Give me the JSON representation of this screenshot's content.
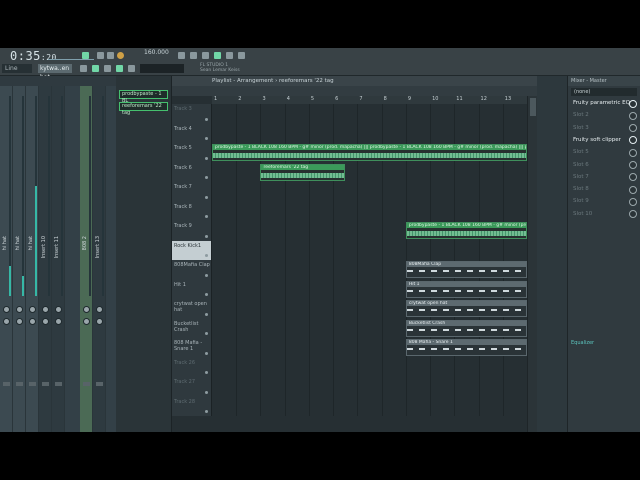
{
  "toolbar": {
    "time_main": "0:35",
    "time_sub": ":20",
    "tempo_value": "160.000",
    "line_label": "Line",
    "preset_label": "kytwa..en hat",
    "hint_lines": [
      "FL STUDIO 1",
      "Sean Lemar Keiss"
    ]
  },
  "mixer": {
    "strips": [
      {
        "name": "hi hat",
        "level": 0.15
      },
      {
        "name": "hi hat",
        "level": 0.1
      },
      {
        "name": "hi hat",
        "level": 0.55
      },
      {
        "name": "Insert 10",
        "level": 0.0
      },
      {
        "name": "Insert 11",
        "level": 0.0
      },
      {
        "name": "808 2",
        "level": 0.0
      },
      {
        "name": "Insert 13",
        "level": 0.0
      }
    ]
  },
  "rack": {
    "clips": [
      "prodbypaste - 1 BL",
      "reeforemars '22 tag"
    ]
  },
  "playlist": {
    "title": "Playlist - Arrangement",
    "pattern": "reeforemars '22 tag",
    "bars": [
      "1",
      "2",
      "3",
      "4",
      "5",
      "6",
      "7",
      "8",
      "9",
      "10",
      "11",
      "12",
      "13"
    ],
    "tracks": [
      {
        "name": "Track 3",
        "dim": true
      },
      {
        "name": "Track 4"
      },
      {
        "name": "Track 5"
      },
      {
        "name": "Track 6"
      },
      {
        "name": "Track 7"
      },
      {
        "name": "Track 8"
      },
      {
        "name": "Track 9"
      },
      {
        "name": "Rock Kick1",
        "highlight": true
      },
      {
        "name": "808Mafia Clap"
      },
      {
        "name": "Hit 1"
      },
      {
        "name": "crytwat open hat"
      },
      {
        "name": "Bucketlist Crash"
      },
      {
        "name": "808 Mafia - Snare 1"
      },
      {
        "name": "Track 26",
        "dim": true
      },
      {
        "name": "Track 27",
        "dim": true
      },
      {
        "name": "Track 28",
        "dim": true
      }
    ],
    "clips": [
      {
        "track": 2,
        "start": 0,
        "end": 13,
        "kind": "audio",
        "label": "prodbypaste - 1 BLACK 108 160 BPM - g# minor (prod. mapacha) ||| prodbypaste - 1 BLACK 108 160 BPM - g# minor (prod. mapacha) ||| prodbypaste - 1 BLACK 108 160 BPM - g# minor (prod. mapacha)"
      },
      {
        "track": 3,
        "start": 2,
        "end": 5.5,
        "kind": "audio",
        "label": "reeforemars '22 tag"
      },
      {
        "track": 6,
        "start": 8,
        "end": 13,
        "kind": "audio",
        "label": "prodbypaste - 1 BLACK 108 160 BPM - g# minor (prod. mapacha)"
      },
      {
        "track": 8,
        "start": 8,
        "end": 13,
        "kind": "pattern",
        "label": "808Mafia Clap"
      },
      {
        "track": 9,
        "start": 8,
        "end": 13,
        "kind": "pattern",
        "label": "Hit 1"
      },
      {
        "track": 10,
        "start": 8,
        "end": 13,
        "kind": "pattern",
        "label": "crytwat open hat"
      },
      {
        "track": 11,
        "start": 8,
        "end": 13,
        "kind": "pattern",
        "label": "Bucketlist Crash"
      },
      {
        "track": 12,
        "start": 8,
        "end": 13,
        "kind": "pattern",
        "label": "808 Mafia - Snare 1"
      }
    ]
  },
  "fx": {
    "title": "Mixer - Master",
    "preset": "(none)",
    "slots": [
      {
        "label": "Fruity parametric EQ 2",
        "active": true
      },
      {
        "label": "Slot 2"
      },
      {
        "label": "Slot 3"
      },
      {
        "label": "Fruity soft clipper",
        "active": true
      },
      {
        "label": "Slot 5"
      },
      {
        "label": "Slot 6"
      },
      {
        "label": "Slot 7"
      },
      {
        "label": "Slot 8"
      },
      {
        "label": "Slot 9"
      },
      {
        "label": "Slot 10"
      }
    ],
    "eq_label": "Equalizer"
  }
}
